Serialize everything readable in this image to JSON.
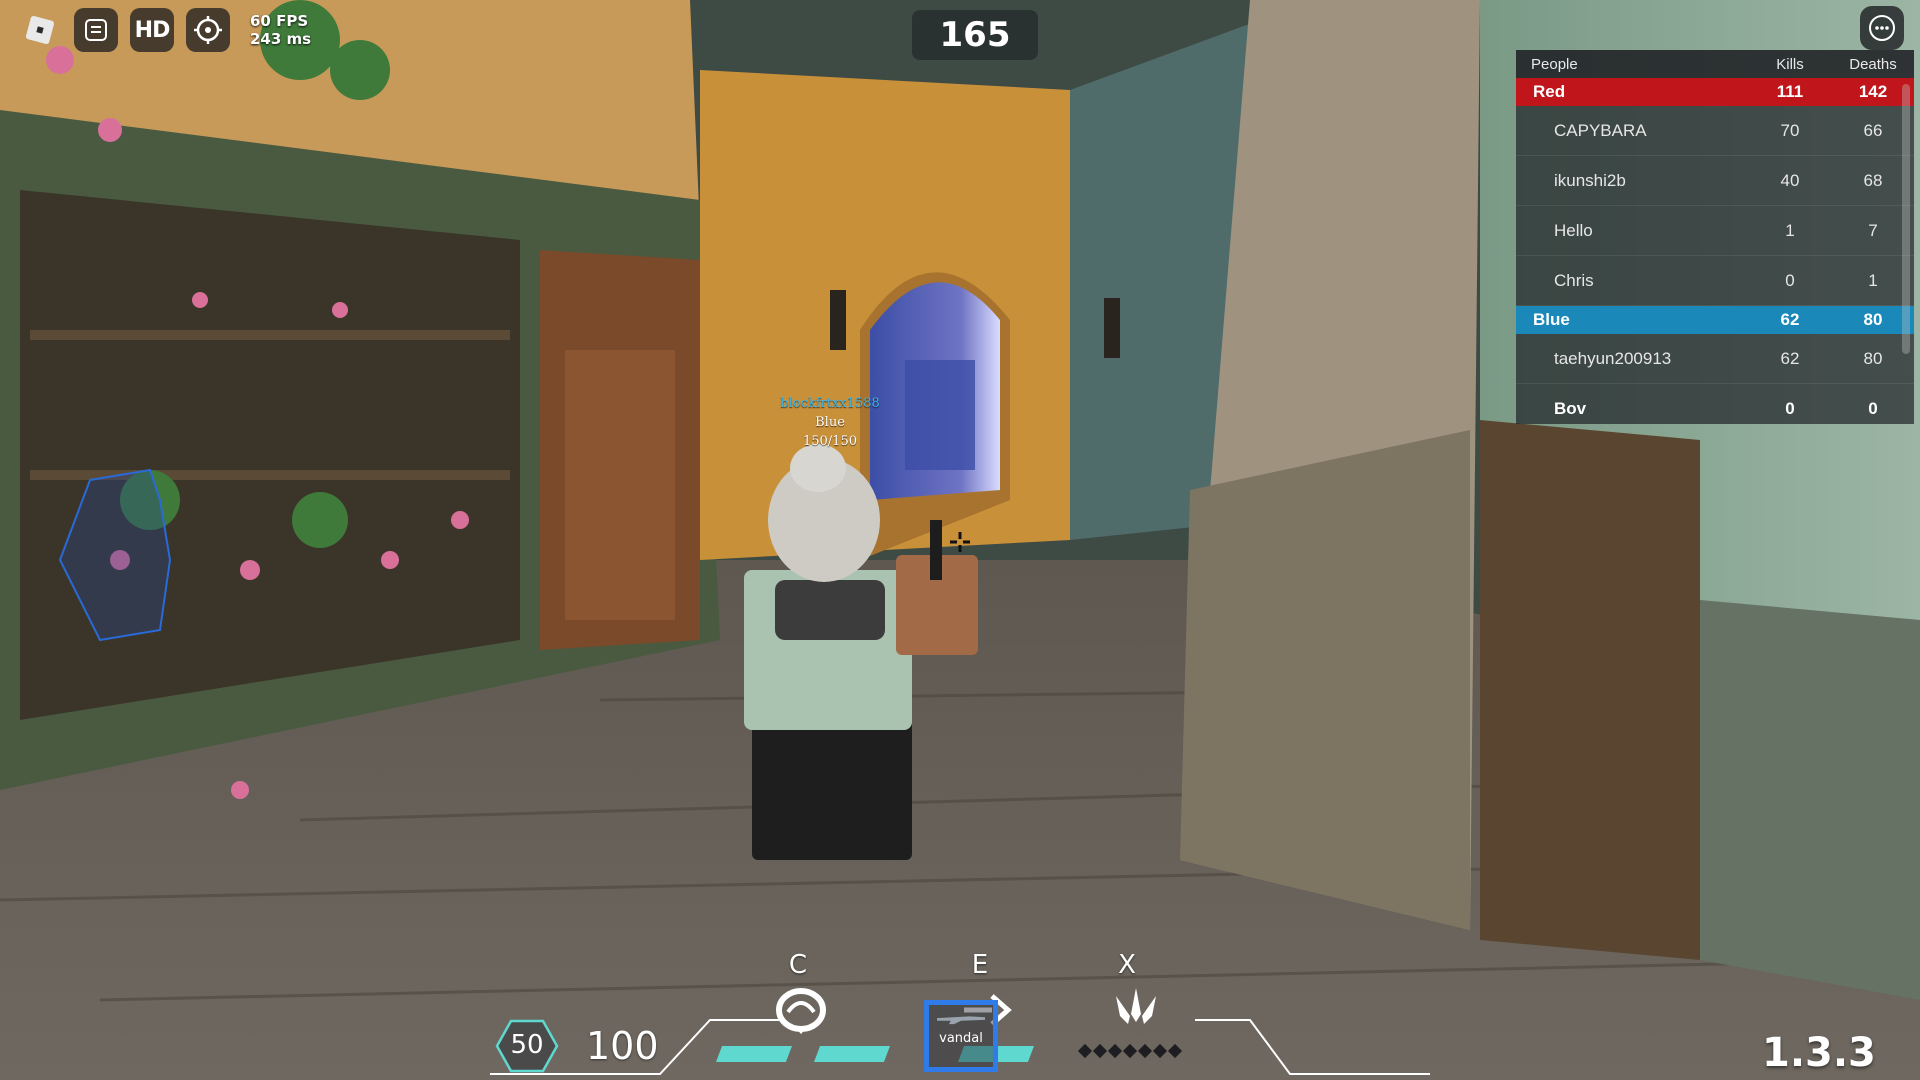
{
  "perf": {
    "fps": "60 FPS",
    "ping": "243 ms"
  },
  "topbar": {
    "hd_label": "HD"
  },
  "round": {
    "timer": "165"
  },
  "leaderboard": {
    "headers": {
      "people": "People",
      "kills": "Kills",
      "deaths": "Deaths"
    },
    "teams": [
      {
        "name": "Red",
        "kills": "111",
        "deaths": "142",
        "color": "#c0161b",
        "players": [
          {
            "name": "CAPYBARA",
            "kills": "70",
            "deaths": "66"
          },
          {
            "name": "ikunshi2b",
            "kills": "40",
            "deaths": "68"
          },
          {
            "name": "Hello",
            "kills": "1",
            "deaths": "7"
          },
          {
            "name": "Chris",
            "kills": "0",
            "deaths": "1"
          }
        ]
      },
      {
        "name": "Blue",
        "kills": "62",
        "deaths": "80",
        "color": "#1a88b8",
        "players": [
          {
            "name": "taehyun200913",
            "kills": "62",
            "deaths": "80"
          },
          {
            "name": "Bov",
            "kills": "0",
            "deaths": "0"
          }
        ]
      }
    ]
  },
  "nametag": {
    "username": "blockfrtxx1588",
    "team": "Blue",
    "health": "150/150"
  },
  "hud": {
    "shield": "50",
    "health": "100",
    "abilities": [
      {
        "key": "C",
        "icon": "swirl-ability-icon",
        "charges": 2
      },
      {
        "key": "E",
        "icon": "dash-ability-icon",
        "charges": 1
      },
      {
        "key": "X",
        "icon": "ultimate-blades-icon",
        "ult_points": 7
      }
    ],
    "weapon": "vandal",
    "version": "1.3.3"
  },
  "colors": {
    "accent_blue": "#2f7bea",
    "charge": "#5fd8d0",
    "red_team": "#c0161b",
    "blue_team": "#1a88b8",
    "name_blue": "#3fb7e8"
  }
}
